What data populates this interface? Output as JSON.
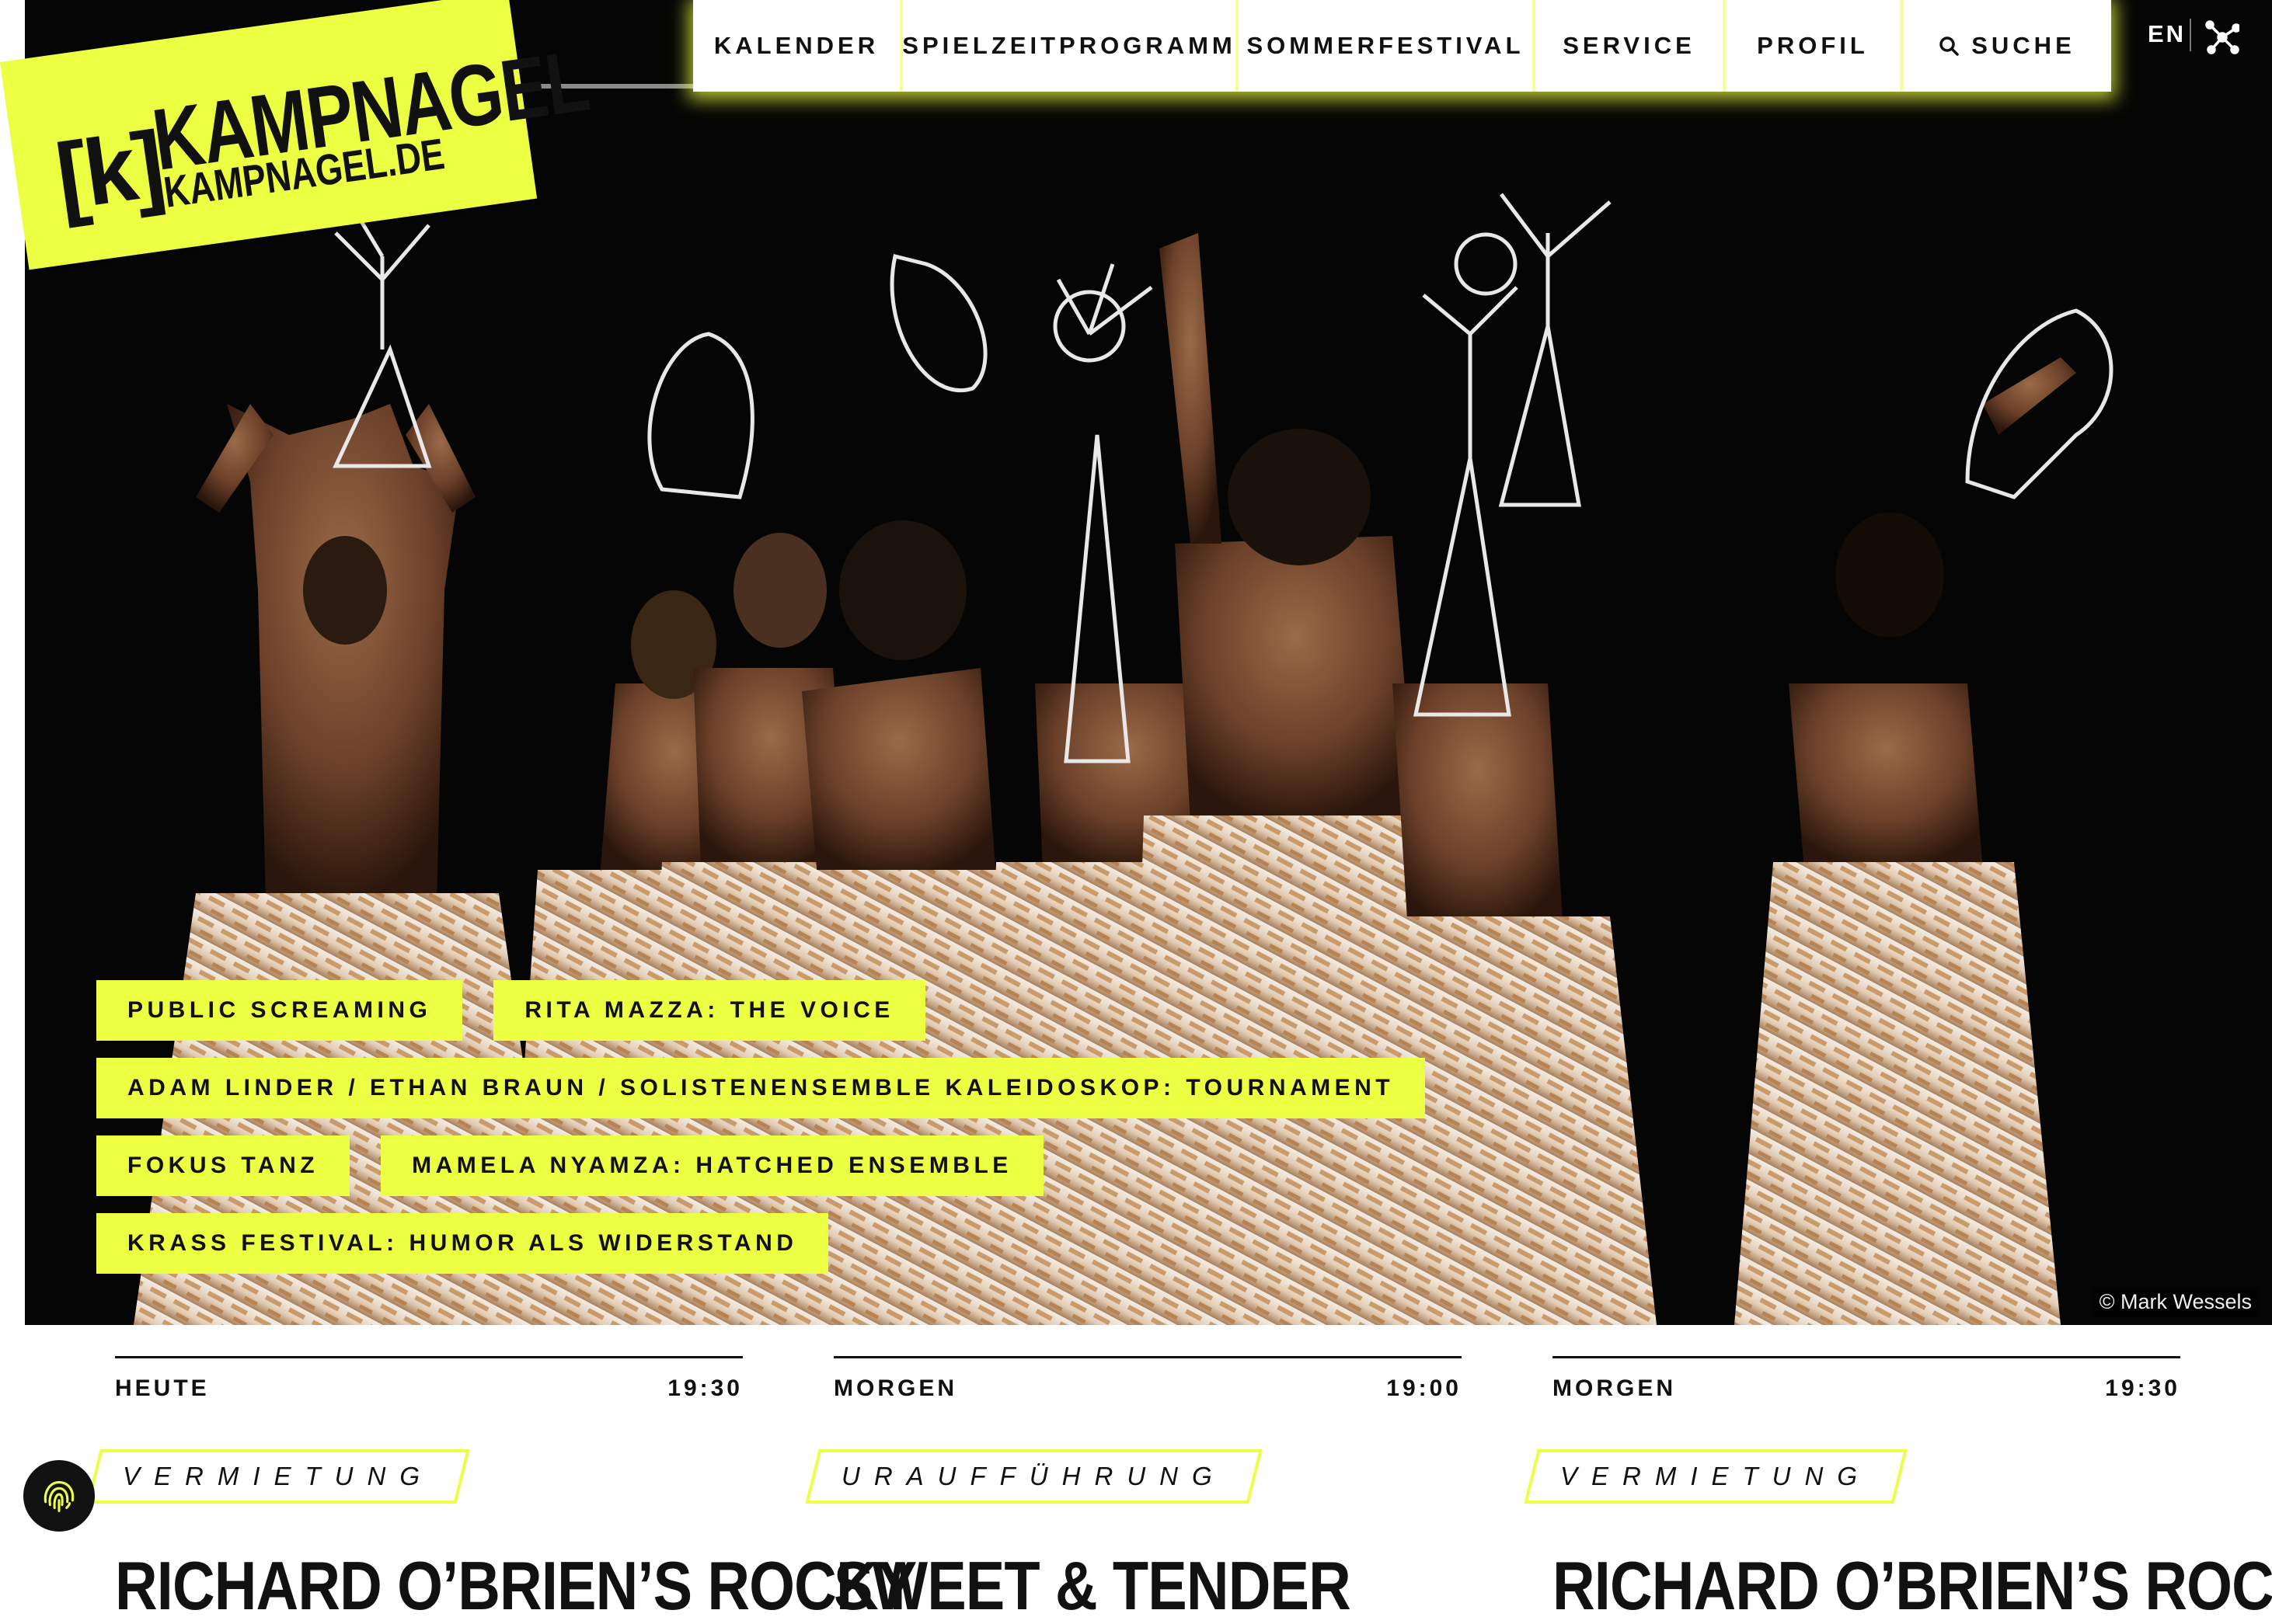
{
  "brand": {
    "logo_mark": "[k]",
    "logo_name": "KAMPNAGEL",
    "logo_url": "KAMPNAGEL.DE",
    "accent": "#ecff42",
    "dark": "#111111"
  },
  "nav": {
    "items": [
      {
        "label": "KALENDER"
      },
      {
        "label": "SPIELZEITPROGRAMM"
      },
      {
        "label": "SOMMERFESTIVAL"
      },
      {
        "label": "SERVICE"
      },
      {
        "label": "PROFIL"
      },
      {
        "label": "SUCHE",
        "icon": "search-icon"
      }
    ],
    "language": "EN",
    "network_icon": "network-icon"
  },
  "hero": {
    "image_description": "Dancers seen from behind holding wire sculptures above their heads, wearing skirts of wooden clothespins",
    "credit": "© Mark Wessels",
    "tags": [
      [
        "PUBLIC SCREAMING",
        "RITA MAZZA: THE VOICE"
      ],
      [
        "ADAM LINDER / ETHAN BRAUN / SOLISTENENSEMBLE KALEIDOSKOP: TOURNAMENT"
      ],
      [
        "FOKUS TANZ",
        "MAMELA NYAMZA: HATCHED ENSEMBLE"
      ],
      [
        "KRASS FESTIVAL: HUMOR ALS WIDERSTAND"
      ]
    ]
  },
  "events": [
    {
      "day": "HEUTE",
      "time": "19:30",
      "badge": "VERMIETUNG",
      "title": "RICHARD O’BRIEN’S ROCKY"
    },
    {
      "day": "MORGEN",
      "time": "19:00",
      "badge": "URAUFFÜHRUNG",
      "title": "SWEET & TENDER"
    },
    {
      "day": "MORGEN",
      "time": "19:30",
      "badge": "VERMIETUNG",
      "title": "RICHARD O’BRIEN’S ROCKY"
    }
  ],
  "floating": {
    "icon": "fingerprint-icon"
  }
}
